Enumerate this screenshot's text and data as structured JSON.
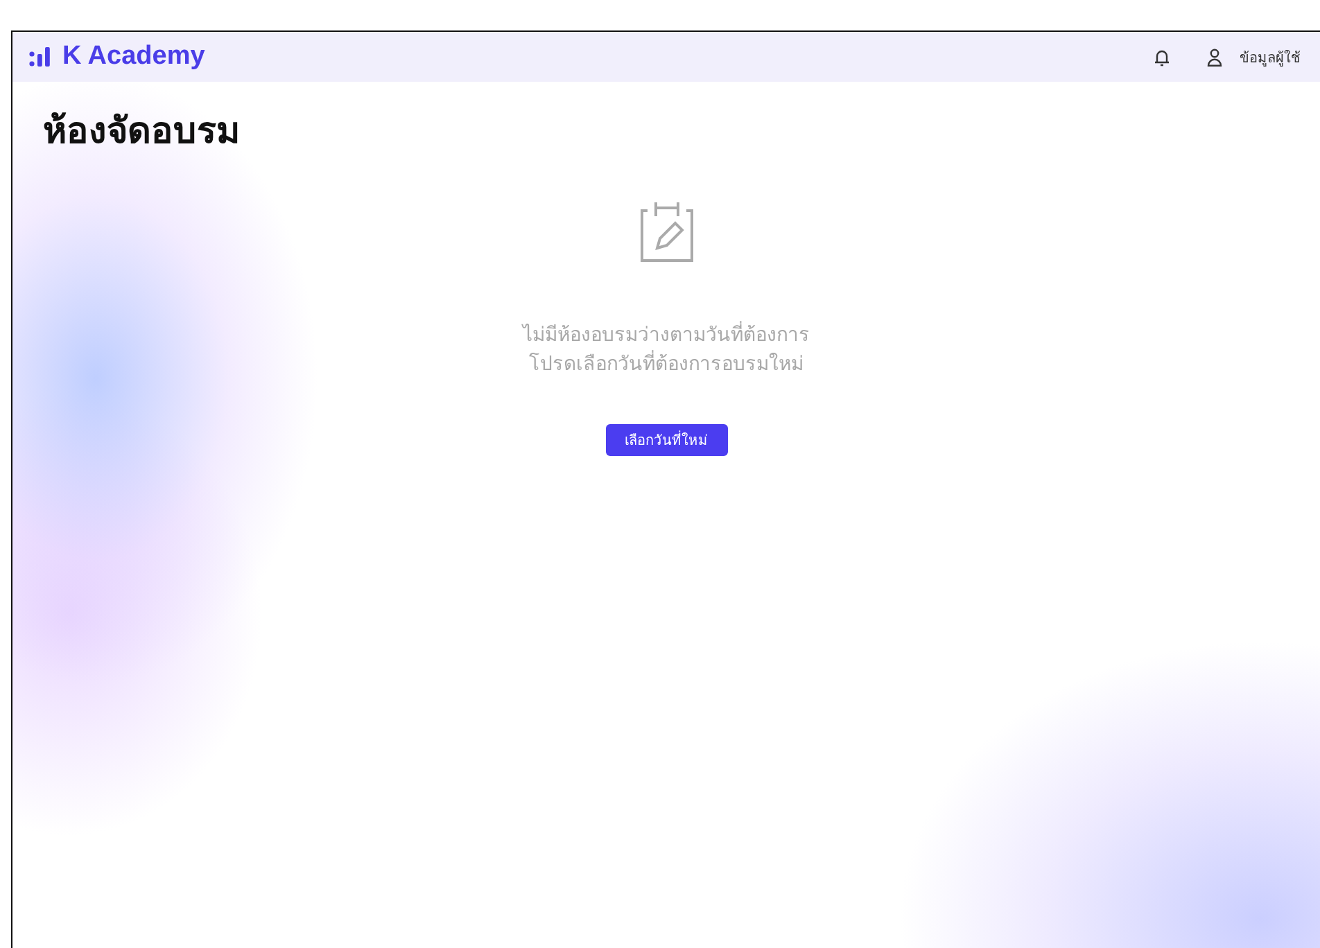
{
  "header": {
    "brand": "K Academy",
    "user_label": "ข้อมูลผู้ใช้"
  },
  "page_title": "ห้องจัดอบรม",
  "empty_state": {
    "lines": [
      "ไม่มีห้องอบรมว่างตามวันที่ต้องการ",
      "โปรดเลือกวันที่ต้องการอบรมใหม่"
    ],
    "button": "เลือกวันที่ใหม่"
  }
}
